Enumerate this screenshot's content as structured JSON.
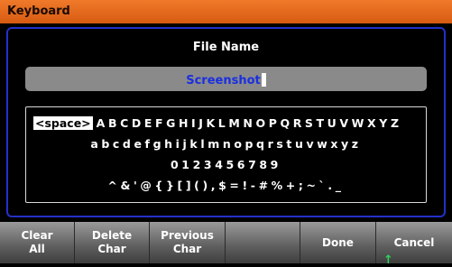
{
  "window": {
    "title": "Keyboard"
  },
  "file_name": {
    "label": "File Name",
    "value": "Screenshot"
  },
  "keyboard": {
    "space_key": "<space>",
    "row1": "ABCDEFGHIJKLMNOPQRSTUVWXYZ",
    "row2": "abcdefghijklmnopqrstuvwxyz",
    "row3": "0123456789",
    "row4": "^&'@{}[](),$=!-#%+;~`._"
  },
  "softkeys": [
    {
      "line1": "Clear",
      "line2": "All"
    },
    {
      "line1": "Delete",
      "line2": "Char"
    },
    {
      "line1": "Previous",
      "line2": "Char"
    },
    {
      "line1": "",
      "line2": ""
    },
    {
      "line1": "Done",
      "line2": ""
    },
    {
      "line1": "Cancel",
      "line2": ""
    }
  ],
  "colors": {
    "title_bar": "#e06a1e",
    "panel_border": "#2430c8",
    "field_text": "#1a2fe0",
    "indicator": "#2fd45a"
  },
  "indicator_icon": "up-arrow-icon"
}
